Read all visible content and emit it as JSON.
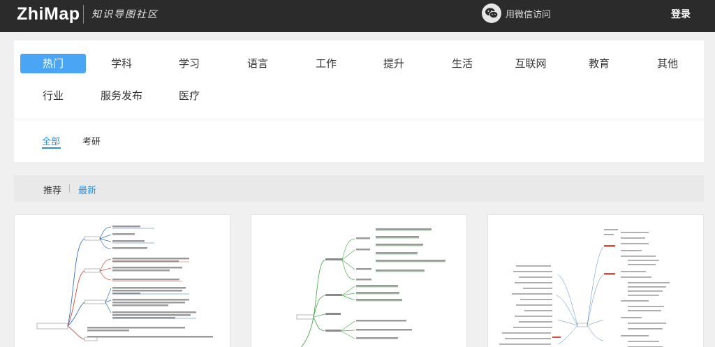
{
  "header": {
    "logo": "ZhiMap",
    "logo_sub": "知识导图社区",
    "wechat_label": "用微信访问",
    "login": "登录"
  },
  "categories": [
    "热门",
    "学科",
    "学习",
    "语言",
    "工作",
    "提升",
    "生活",
    "互联网",
    "教育",
    "其他",
    "行业",
    "服务发布",
    "医疗"
  ],
  "active_category": "热门",
  "subcategories": [
    "全部",
    "考研"
  ],
  "active_subcategory": "全部",
  "sort": {
    "options": [
      "推荐",
      "最新"
    ],
    "active": "最新"
  },
  "colors": {
    "accent": "#4aa6f5",
    "link": "#2a8fd8",
    "topbar": "#2b2b2b"
  },
  "cards": [
    {
      "type": "mind-map-thumbnail",
      "style": "left-tree-red-blue"
    },
    {
      "type": "mind-map-thumbnail",
      "style": "center-tree-green"
    },
    {
      "type": "mind-map-thumbnail",
      "style": "radial-dense-red"
    }
  ]
}
